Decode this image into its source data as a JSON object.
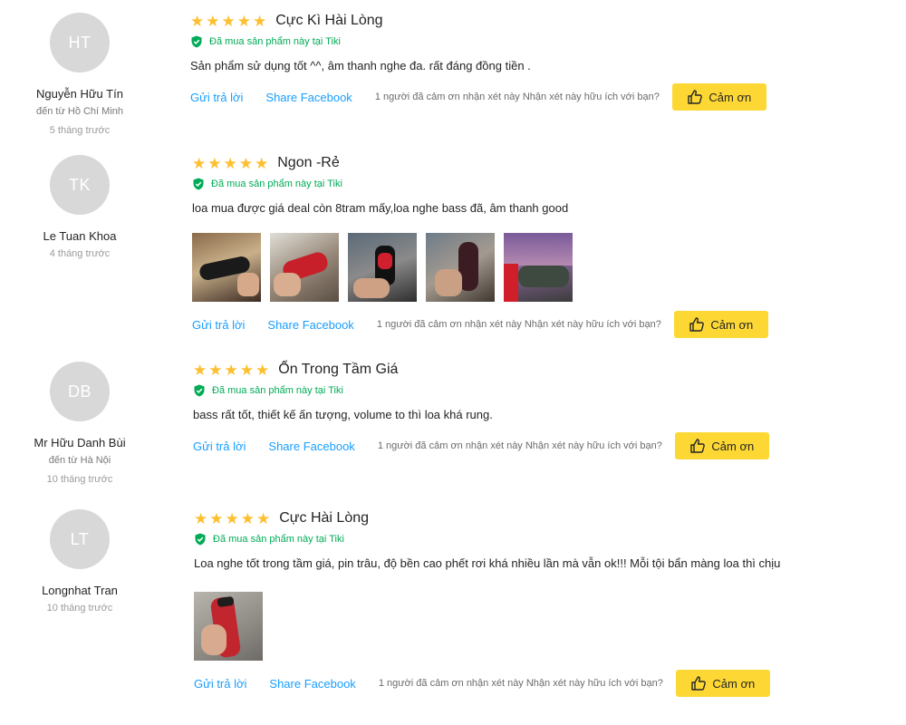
{
  "verified_label": "Đã mua sản phẩm này tại Tiki",
  "reply_label": "Gửi trả lời",
  "share_label": "Share Facebook",
  "thanks_label": "Cảm ơn",
  "star_color": "#fdbf2e",
  "accent_color": "#fdd835",
  "link_color": "#189eff",
  "verified_color": "#00ab56",
  "reviews": [
    {
      "initials": "HT",
      "name": "Nguyễn Hữu Tín",
      "location": "đến từ Hồ Chí Minh",
      "time": "5 tháng trước",
      "rating": 5,
      "title": "Cực Kì Hài Lòng",
      "text": "Sản phẩm sử dụng tốt ^^, âm thanh nghe đa. rất đáng đồng tiền .",
      "helpful": "1 người đã cảm ơn nhận xét này Nhận xét này hữu ích với bạn?",
      "photos": []
    },
    {
      "initials": "TK",
      "name": "Le Tuan Khoa",
      "location": "",
      "time": "4 tháng trước",
      "rating": 5,
      "title": "Ngon -Rẻ",
      "text": "loa mua được giá deal còn 8tram mấy,loa nghe bass đã, âm thanh good",
      "helpful": "1 người đã cảm ơn nhận xét này Nhận xét này hữu ích với bạn?",
      "photos": [
        "speaker-photo-1",
        "speaker-photo-2",
        "speaker-photo-3",
        "speaker-photo-4",
        "speaker-photo-5"
      ]
    },
    {
      "initials": "DB",
      "name": "Mr Hữu Danh Bùi",
      "location": "đến từ Hà Nội",
      "time": "10 tháng trước",
      "rating": 5,
      "title": "Ổn Trong Tầm Giá",
      "text": "bass rất tốt, thiết kế ấn tượng, volume to thì loa khá rung.",
      "helpful": "1 người đã cảm ơn nhận xét này Nhận xét này hữu ích với bạn?",
      "photos": []
    },
    {
      "initials": "LT",
      "name": "Longnhat Tran",
      "location": "",
      "time": "10 tháng trước",
      "rating": 5,
      "title": "Cực Hài Lòng",
      "text": "Loa nghe tốt trong tầm giá, pin trâu, độ bền cao phết rơi khá nhiều lần mà vẫn ok!!! Mỗi tội bẩn màng loa thì chịu",
      "helpful": "1 người đã cảm ơn nhận xét này Nhận xét này hữu ích với bạn?",
      "photos": [
        "speaker-in-hand-photo"
      ]
    }
  ]
}
